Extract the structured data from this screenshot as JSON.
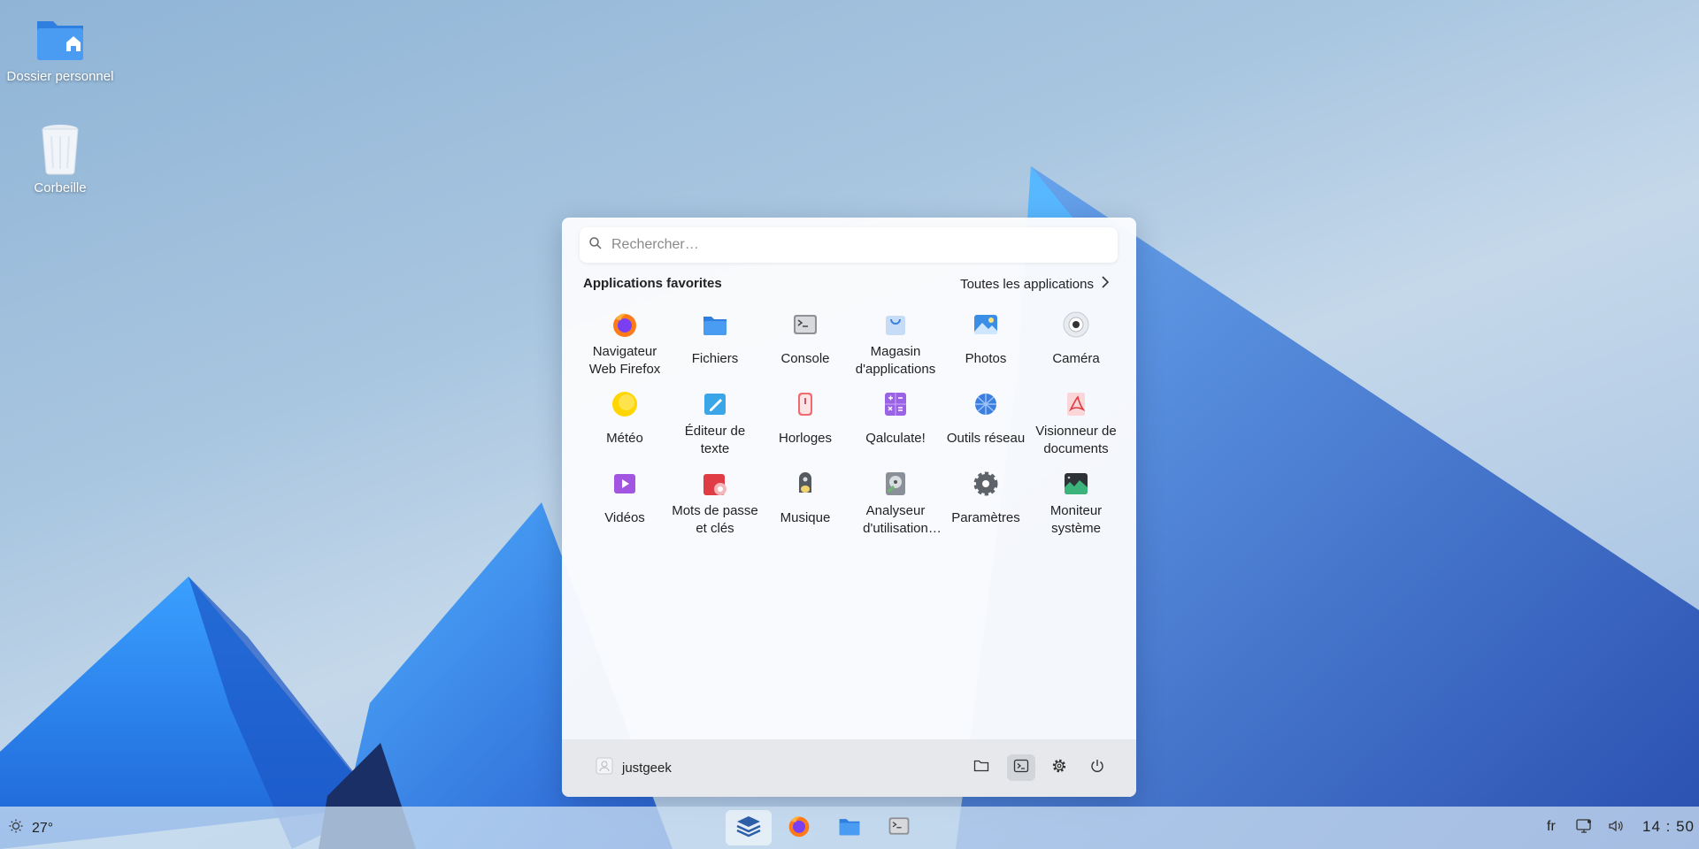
{
  "desktop": {
    "icons": [
      {
        "label": "Dossier personnel",
        "icon": "home-folder-icon"
      },
      {
        "label": "Corbeille",
        "icon": "trash-icon"
      }
    ]
  },
  "launcher": {
    "search": {
      "placeholder": "Rechercher…",
      "value": ""
    },
    "favorites_title": "Applications favorites",
    "all_apps_label": "Toutes les applications",
    "apps": [
      {
        "label": "Navigateur Web Firefox",
        "icon": "firefox-icon"
      },
      {
        "label": "Fichiers",
        "icon": "folder-icon"
      },
      {
        "label": "Console",
        "icon": "terminal-icon"
      },
      {
        "label": "Magasin d'applications",
        "icon": "store-icon"
      },
      {
        "label": "Photos",
        "icon": "photos-icon"
      },
      {
        "label": "Caméra",
        "icon": "camera-icon"
      },
      {
        "label": "Météo",
        "icon": "weather-icon"
      },
      {
        "label": "Éditeur de texte",
        "icon": "text-editor-icon"
      },
      {
        "label": "Horloges",
        "icon": "clock-icon"
      },
      {
        "label": "Qalculate!",
        "icon": "calculator-icon"
      },
      {
        "label": "Outils réseau",
        "icon": "network-tools-icon"
      },
      {
        "label": "Visionneur de documents",
        "icon": "document-viewer-icon"
      },
      {
        "label": "Vidéos",
        "icon": "videos-icon"
      },
      {
        "label": "Mots de passe et clés",
        "icon": "passwords-icon"
      },
      {
        "label": "Musique",
        "icon": "music-icon"
      },
      {
        "label": "Analyseur d'utilisation des disques",
        "icon": "disk-usage-icon"
      },
      {
        "label": "Paramètres",
        "icon": "settings-icon"
      },
      {
        "label": "Moniteur système",
        "icon": "system-monitor-icon"
      }
    ],
    "footer": {
      "username": "justgeek"
    }
  },
  "taskbar": {
    "weather": {
      "temperature": "27°"
    },
    "language": "fr",
    "clock": "14 : 50"
  },
  "colors": {
    "accent": "#3a8ee6",
    "taskbar": "#c8dcf0"
  }
}
